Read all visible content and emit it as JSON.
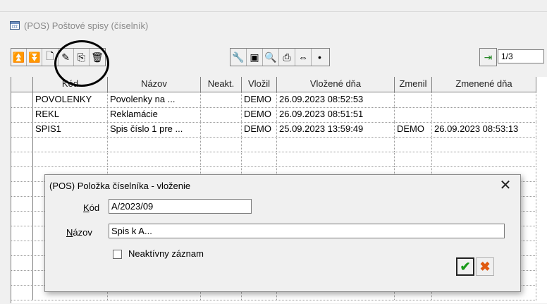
{
  "window": {
    "title": "(POS) Poštové spisy (číselník)"
  },
  "toolbar": {
    "group1": [
      {
        "name": "first-record-icon",
        "glyph": "⏫"
      },
      {
        "name": "last-record-icon",
        "glyph": "⏬"
      },
      {
        "name": "new-record-icon",
        "glyph": "🗋"
      },
      {
        "name": "edit-record-icon",
        "glyph": "✎"
      },
      {
        "name": "copy-record-icon",
        "glyph": "⎘"
      },
      {
        "name": "delete-record-icon",
        "glyph": "🗑"
      }
    ],
    "group2": [
      {
        "name": "settings-wrench-icon",
        "glyph": "🔧"
      },
      {
        "name": "monitor-icon",
        "glyph": "▣"
      },
      {
        "name": "search-icon",
        "glyph": "🔍"
      },
      {
        "name": "print-icon",
        "glyph": "⎙"
      },
      {
        "name": "export-icon",
        "glyph": "⇔"
      },
      {
        "name": "point-icon",
        "glyph": "•"
      }
    ],
    "exit_icon": {
      "name": "exit-door-icon",
      "glyph": "⇥"
    },
    "pager_value": "1/3"
  },
  "grid": {
    "columns": [
      "Kód",
      "Názov",
      "Neakt.",
      "Vložil",
      "Vložené dňa",
      "Zmenil",
      "Zmenené dňa"
    ],
    "rows": [
      [
        "POVOLENKY",
        "Povolenky na ...",
        "",
        "DEMO",
        "26.09.2023 08:52:53",
        "",
        ""
      ],
      [
        "REKL",
        "Reklamácie",
        "",
        "DEMO",
        "26.09.2023 08:51:51",
        "",
        ""
      ],
      [
        "SPIS1",
        "Spis číslo 1 pre ...",
        "",
        "DEMO",
        "25.09.2023 13:59:49",
        "DEMO",
        "26.09.2023 08:53:13"
      ]
    ]
  },
  "dialog": {
    "title": "(POS) Položka číselníka - vloženie",
    "close_glyph": "✕",
    "kod_label_accel": "K",
    "kod_label_rest": "ód",
    "kod_value": "A/2023/09",
    "nazov_label_accel": "N",
    "nazov_label_rest": "ázov",
    "nazov_value": "Spis k A...",
    "checkbox_label": "Neaktívny záznam",
    "ok_glyph": "✔",
    "cancel_glyph": "✖"
  },
  "colors": {
    "ok": "#1a9a1a",
    "cancel": "#e05a10"
  }
}
